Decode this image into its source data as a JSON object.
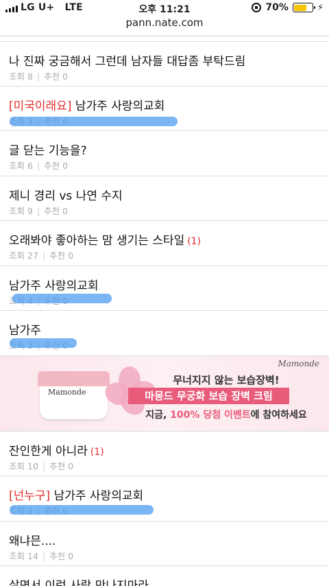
{
  "status_bar": {
    "carrier": "LG U+",
    "network": "LTE",
    "time": "오후 11:21",
    "battery_percent": "70%",
    "battery_level": 0.7
  },
  "browser": {
    "url": "pann.nate.com"
  },
  "labels": {
    "views": "조회",
    "recommend": "추천"
  },
  "posts": [
    {
      "tag": "",
      "title": "나 진짜 궁금해서 그런데 남자들 대답좀 부탁드림",
      "comments": "",
      "views": "8",
      "recommends": "0"
    },
    {
      "tag": "[미국이래요]",
      "title": " 남가주 사랑의교회",
      "comments": "",
      "views": "3",
      "recommends": "0"
    },
    {
      "tag": "",
      "title": "글 닫는 기능을?",
      "comments": "",
      "views": "6",
      "recommends": "0"
    },
    {
      "tag": "",
      "title": "제니 경리 vs 나연 수지",
      "comments": "",
      "views": "9",
      "recommends": "0"
    },
    {
      "tag": "",
      "title": "오래봐야 좋아하는 맘 생기는 스타일",
      "comments": "(1)",
      "views": "27",
      "recommends": "0"
    },
    {
      "tag": "",
      "title": "남가주 사랑의교회",
      "comments": "",
      "views": "4",
      "recommends": "0"
    },
    {
      "tag": "",
      "title": "남가주",
      "comments": "",
      "views": "3",
      "recommends": "0"
    },
    {
      "tag": "",
      "title": "잔인한게 아니라",
      "comments": "(1)",
      "views": "10",
      "recommends": "0"
    },
    {
      "tag": "[넌누구]",
      "title": " 남가주 사랑의교회",
      "comments": "",
      "views": "2",
      "recommends": "0"
    },
    {
      "tag": "",
      "title": "왜냐믄....",
      "comments": "",
      "views": "14",
      "recommends": "0"
    },
    {
      "tag": "",
      "title": "살면서 이런 사람 만나지마라",
      "comments": "",
      "views": "",
      "recommends": ""
    }
  ],
  "ad": {
    "brand": "Mamonde",
    "jar_label": "Mamonde",
    "line1": "무너지지 않는 보습장벽!",
    "line2": "마몽드 무궁화 보습 장벽 크림",
    "line3_pre": "지금, ",
    "line3_highlight": "100% 당첨 이벤트",
    "line3_post": "에 참여하세요"
  }
}
